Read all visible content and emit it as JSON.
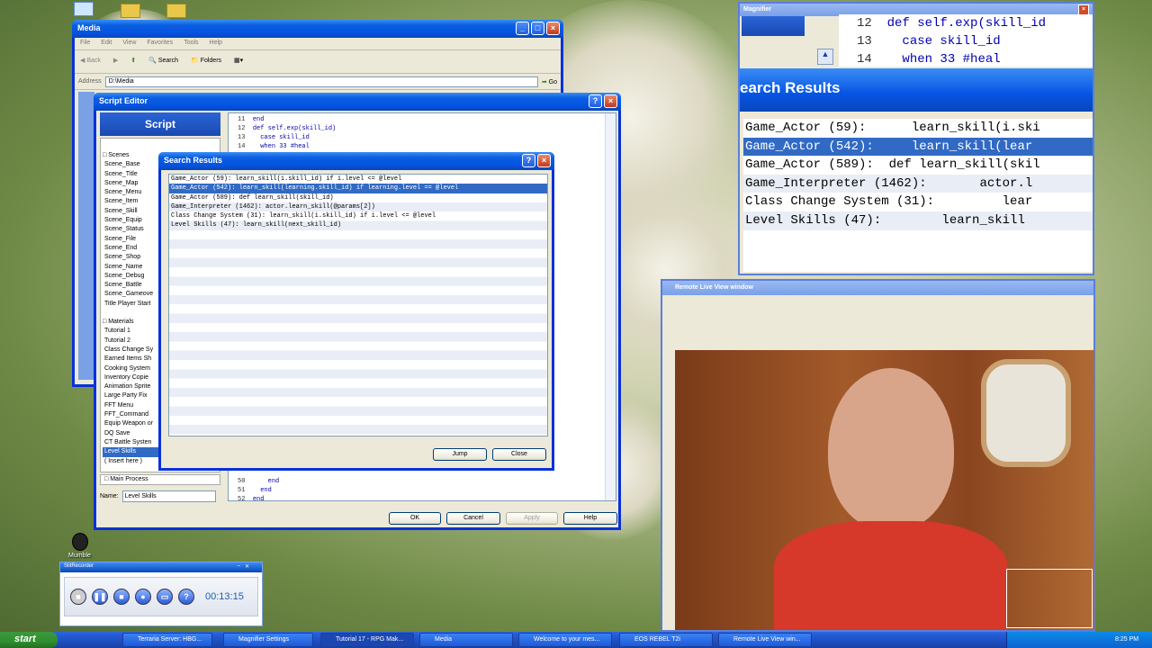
{
  "media_window": {
    "title": "Media",
    "menu": [
      "File",
      "Edit",
      "View",
      "Favorites",
      "Tools",
      "Help"
    ],
    "back": "Back",
    "search": "Search",
    "folders": "Folders",
    "address_label": "Address",
    "address": "D:\\Media",
    "go": "Go"
  },
  "script_editor": {
    "title": "Script Editor",
    "panel_title": "Script",
    "scenes_header": "Scenes",
    "scenes": [
      "Scene_Base",
      "Scene_Title",
      "Scene_Map",
      "Scene_Menu",
      "Scene_Item",
      "Scene_Skill",
      "Scene_Equip",
      "Scene_Status",
      "Scene_File",
      "Scene_End",
      "Scene_Shop",
      "Scene_Name",
      "Scene_Debug",
      "Scene_Battle",
      "Scene_Gameove",
      "Title Player Start"
    ],
    "materials_header": "Materials",
    "materials": [
      "Tutorial 1",
      "Tutorial 2",
      "Class Change Sy",
      "Earned Items Sh",
      "Cooking System",
      "Inventory Copie",
      "Animation Sprite",
      "Large Party Fix",
      "FFT Menu",
      "FFT_Command",
      "Equip Weapon or",
      "DQ Save",
      "CT Battle Systen",
      "Level Skills",
      "( Insert here )"
    ],
    "main_process": "Main Process",
    "name_label": "Name:",
    "name_value": "Level Skills",
    "code_top": [
      {
        "n": "11",
        "t": "end"
      },
      {
        "n": "12",
        "t": "def self.exp(skill_id)"
      },
      {
        "n": "13",
        "t": "  case skill_id"
      },
      {
        "n": "14",
        "t": "  when 33 #heal"
      }
    ],
    "code_bottom": [
      {
        "n": "50",
        "t": "    end"
      },
      {
        "n": "51",
        "t": "  end"
      },
      {
        "n": "52",
        "t": "end"
      }
    ],
    "ok": "OK",
    "cancel": "Cancel",
    "apply": "Apply",
    "help": "Help"
  },
  "search_results": {
    "title": "Search Results",
    "rows": [
      "Game_Actor (59):        learn_skill(i.skill_id) if i.level <= @level",
      "Game_Actor (542):        learn_skill(learning.skill_id) if learning.level == @level",
      "Game_Actor (589):    def learn_skill(skill_id)",
      "Game_Interpreter (1462):          actor.learn_skill(@params[2])",
      "Class Change System (31):            learn_skill(i.skill_id) if i.level <= @level",
      "Level Skills (47):           learn_skill(next_skill_id)"
    ],
    "jump": "Jump",
    "close": "Close"
  },
  "magnifier": {
    "title": "Magnifier",
    "code": [
      {
        "n": "12",
        "t": "def self.exp(skill_id"
      },
      {
        "n": "13",
        "t": "  case skill_id"
      },
      {
        "n": "14",
        "t": "  when 33 #heal"
      }
    ],
    "header": "earch Results",
    "rows": [
      "Game_Actor (59):      learn_skill(i.ski",
      "Game_Actor (542):     learn_skill(lear",
      "Game_Actor (589):  def learn_skill(skil",
      "Game_Interpreter (1462):       actor.l",
      "Class Change System (31):         lear",
      "Level Skills (47):        learn_skill"
    ]
  },
  "remote": {
    "title": "Remote Live View window"
  },
  "recorder": {
    "title": "SlitRecorder",
    "time": "00:13:15"
  },
  "desktop": {
    "mumble": "Mumble"
  },
  "taskbar": {
    "start": "start",
    "items": [
      "Terraria Server: HBG...",
      "Magnifier Settings",
      "Tutorial 17 - RPG Mak...",
      "Media",
      "Welcome to your mes...",
      "EOS REBEL T2i",
      "Remote Live View win..."
    ],
    "clock": "8:25 PM"
  }
}
